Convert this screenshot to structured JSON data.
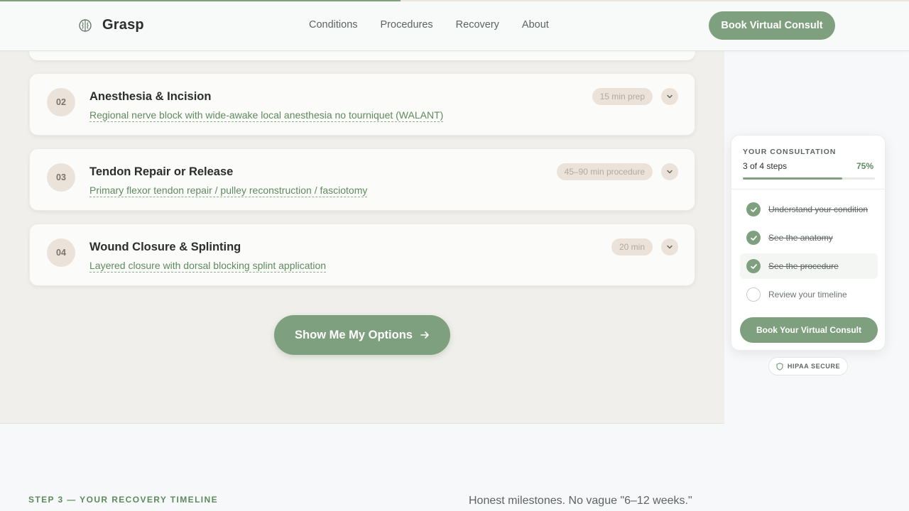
{
  "header": {
    "brand": "Grasp",
    "nav": [
      "Conditions",
      "Procedures",
      "Recovery",
      "About"
    ],
    "cta": "Book Virtual Consult"
  },
  "steps": [
    {
      "number": "02",
      "title": "Anesthesia & Incision",
      "description": "Regional nerve block with wide-awake local anesthesia no tourniquet (WALANT)",
      "badge": "15 min prep"
    },
    {
      "number": "03",
      "title": "Tendon Repair or Release",
      "description": "Primary flexor tendon repair / pulley reconstruction / fasciotomy",
      "badge": "45–90 min procedure"
    },
    {
      "number": "04",
      "title": "Wound Closure & Splinting",
      "description": "Layered closure with dorsal blocking splint application",
      "badge": "20 min"
    }
  ],
  "options_button": "Show Me My Options",
  "consultation": {
    "eyebrow": "YOUR CONSULTATION",
    "count": "3 of 4 steps",
    "percent": "75%",
    "progress": 0.75,
    "items": [
      {
        "label": "Understand your condition",
        "done": true
      },
      {
        "label": "See the anatomy",
        "done": true
      },
      {
        "label": "See the procedure",
        "done": true
      },
      {
        "label": "Review your timeline",
        "done": false
      }
    ],
    "cta": "Book Your Virtual Consult"
  },
  "hipaa": "HIPAA SECURE",
  "recovery": {
    "eyebrow": "STEP 3 — YOUR RECOVERY TIMELINE",
    "tagline": "Honest milestones. No vague \"6–12 weeks.\""
  },
  "colors": {
    "accent": "#7fa07e",
    "accent_text": "#5f8a5e",
    "panel": "#f0efeb",
    "badge": "#ebe3da"
  }
}
